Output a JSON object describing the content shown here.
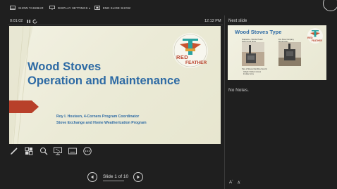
{
  "toolbar": {
    "show_taskbar": "SHOW TASKBAR",
    "display_settings": "DISPLAY SETTINGS ▾",
    "end_slide_show": "END SLIDE SHOW"
  },
  "presenter": {
    "timer": "0:01:02",
    "clock": "12:12 PM",
    "next_slide_label": "Next slide",
    "notes": "No Notes.",
    "slide_counter": "Slide 1 of 10",
    "font_increase": "A",
    "font_decrease": "A"
  },
  "current_slide": {
    "title_line1": "Wood Stoves",
    "title_line2": "Operation and Maintenance",
    "subtitle_line1": "Roy I. Hosteen, 4-Corners Program Coordinator",
    "subtitle_line2": "Stove Exchange and Home Weatherization Program",
    "logo_word1": "RED",
    "logo_word2": "FEATHER"
  },
  "next_slide": {
    "title": "Wood Stoves Type",
    "caption_left": "Soapstone - Wonder Heater Nickel Scroll Stone",
    "caption_right": "Fire Stove Company Woodmaster",
    "caption_bottom1": "Type of Stoves that Were found in",
    "caption_bottom2": "Airtight / Modern stoves",
    "caption_bottom3": "Insulate home",
    "logo_word1": "RED",
    "logo_word2": "FEATHER"
  },
  "colors": {
    "background": "#1f1f1f",
    "slide_title": "#2d6aa4",
    "arrow_red": "#b8402a"
  }
}
